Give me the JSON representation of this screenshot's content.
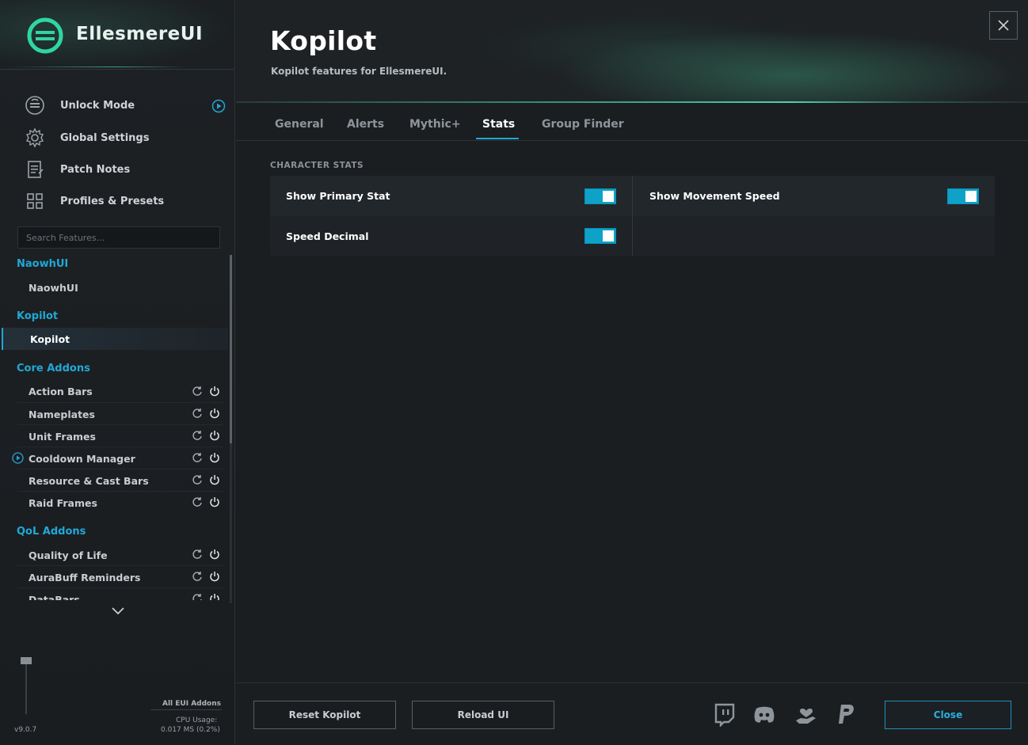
{
  "app": {
    "name": "EllesmereUI",
    "version": "v9.0.7"
  },
  "colors": {
    "accent": "#22a6d5",
    "toggle_on": "#0ea2c9",
    "brand_green": "#2fd6a0"
  },
  "sidebar": {
    "nav": [
      {
        "label": "Unlock Mode",
        "icon": "unlock-mode-icon"
      },
      {
        "label": "Global Settings",
        "icon": "gear-icon"
      },
      {
        "label": "Patch Notes",
        "icon": "notes-icon"
      },
      {
        "label": "Profiles & Presets",
        "icon": "grid-icon"
      }
    ],
    "search_placeholder": "Search Features...",
    "groups": [
      {
        "title": "NaowhUI",
        "items": [
          "NaowhUI"
        ]
      },
      {
        "title": "Kopilot",
        "items": [
          "Kopilot"
        ]
      },
      {
        "title": "Core Addons",
        "items": [
          "Action Bars",
          "Nameplates",
          "Unit Frames",
          "Cooldown Manager",
          "Resource & Cast Bars",
          "Raid Frames"
        ]
      },
      {
        "title": "QoL Addons",
        "items": [
          "Quality of Life",
          "AuraBuff Reminders",
          "DataBars"
        ]
      }
    ],
    "footer": {
      "all_addons": "All EUI Addons",
      "cpu_label": "CPU Usage:",
      "cpu_value": "0.017 MS (0.2%)"
    }
  },
  "header": {
    "title": "Kopilot",
    "subtitle": "Kopilot features for EllesmereUI."
  },
  "tabs": [
    {
      "label": "General",
      "active": false
    },
    {
      "label": "Alerts",
      "active": false
    },
    {
      "label": "Mythic+",
      "active": false
    },
    {
      "label": "Stats",
      "active": true
    },
    {
      "label": "Group Finder",
      "active": false
    }
  ],
  "section": {
    "label": "CHARACTER STATS",
    "options": [
      {
        "label": "Show Primary Stat",
        "enabled": true
      },
      {
        "label": "Show Movement Speed",
        "enabled": true
      },
      {
        "label": "Speed Decimal",
        "enabled": true
      }
    ]
  },
  "footer": {
    "reset_label": "Reset Kopilot",
    "reload_label": "Reload UI",
    "close_label": "Close",
    "socials": [
      "twitch-icon",
      "discord-icon",
      "donate-heart-icon",
      "paypal-icon"
    ]
  }
}
